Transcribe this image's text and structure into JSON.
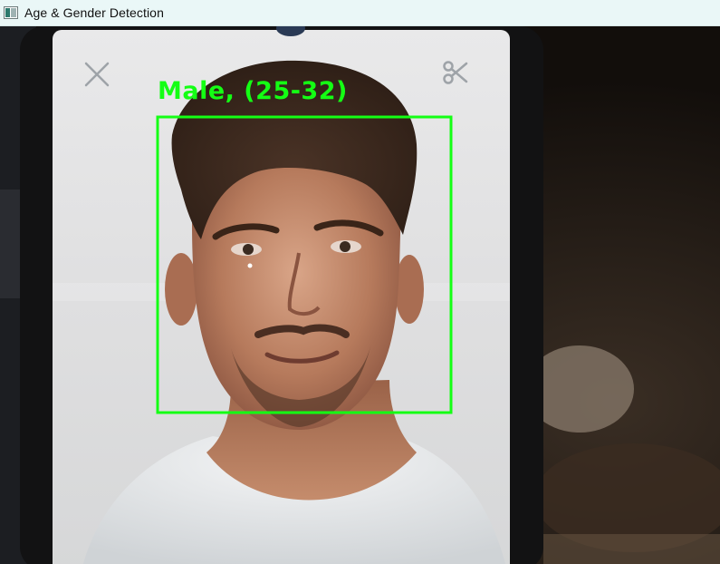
{
  "window": {
    "title": "Age & Gender Detection",
    "icon": "app-window-icon"
  },
  "detection": {
    "label": "Male, (25-32)",
    "box_color": "#14ff14"
  },
  "phone_overlay_icons": [
    "close-icon",
    "scissors-icon"
  ]
}
